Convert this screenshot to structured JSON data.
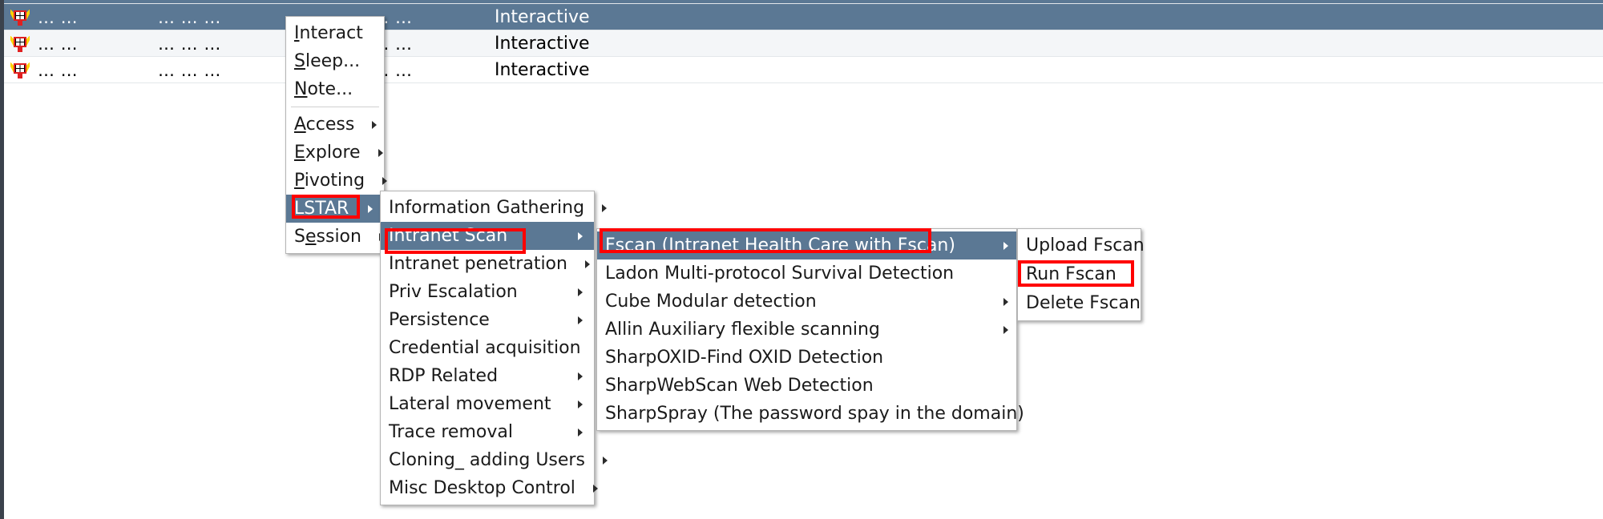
{
  "app": {
    "theme_accent": "#5b7894",
    "highlight_box_color": "#ff0000",
    "row_alt_color": "#f4f6f8"
  },
  "beacon_table": {
    "rows": [
      {
        "icon": "beacon-monitor-icon",
        "c1": "…  …",
        "c2": "…  …  …",
        "c3": "…  …  …  …",
        "c4": "Interactive",
        "selected": true
      },
      {
        "icon": "beacon-monitor-icon",
        "c1": "…  …",
        "c2": "…  …  …",
        "c3": "…  …  …  …",
        "c4": "Interactive",
        "selected": false
      },
      {
        "icon": "beacon-monitor-icon",
        "c1": "…  …",
        "c2": "…  …  …",
        "c3": "…  …  …  …",
        "c4": "Interactive",
        "selected": false
      }
    ]
  },
  "context_menu": {
    "items": [
      {
        "label": "Interact",
        "mnemonic": "I",
        "submenu": false,
        "selected": false
      },
      {
        "label": "Sleep...",
        "mnemonic": "S",
        "submenu": false,
        "selected": false
      },
      {
        "label": "Note...",
        "mnemonic": "N",
        "submenu": false,
        "selected": false
      },
      {
        "separator": true
      },
      {
        "label": "Access",
        "mnemonic": "A",
        "submenu": true,
        "selected": false
      },
      {
        "label": "Explore",
        "mnemonic": "E",
        "submenu": true,
        "selected": false
      },
      {
        "label": "Pivoting",
        "mnemonic": "P",
        "submenu": true,
        "selected": false
      },
      {
        "label": "LSTAR",
        "mnemonic": "L",
        "submenu": true,
        "selected": true,
        "highlighted": true
      },
      {
        "label": "Session",
        "mnemonic": "e",
        "submenu": true,
        "selected": false
      }
    ]
  },
  "lstar_menu": {
    "items": [
      {
        "label": "Information Gathering",
        "submenu": true,
        "selected": false
      },
      {
        "label": "Intranet Scan",
        "submenu": true,
        "selected": true,
        "highlighted": true
      },
      {
        "label": "Intranet penetration",
        "submenu": true,
        "selected": false
      },
      {
        "label": "Priv Escalation",
        "submenu": true,
        "selected": false
      },
      {
        "label": "Persistence",
        "submenu": true,
        "selected": false
      },
      {
        "label": "Credential acquisition",
        "submenu": true,
        "selected": false
      },
      {
        "label": "RDP Related",
        "submenu": true,
        "selected": false
      },
      {
        "label": "Lateral movement",
        "submenu": true,
        "selected": false
      },
      {
        "label": "Trace removal",
        "submenu": true,
        "selected": false
      },
      {
        "label": "Cloning_ adding Users",
        "submenu": true,
        "selected": false
      },
      {
        "label": "Misc Desktop Control",
        "submenu": true,
        "selected": false
      }
    ]
  },
  "intranet_scan_menu": {
    "items": [
      {
        "label": "Fscan (Intranet Health Care with Fscan)",
        "submenu": true,
        "selected": true,
        "highlighted": true
      },
      {
        "label": "Ladon Multi-protocol Survival Detection",
        "submenu": false,
        "selected": false
      },
      {
        "label": "Cube Modular detection",
        "submenu": true,
        "selected": false
      },
      {
        "label": "Allin Auxiliary flexible scanning",
        "submenu": true,
        "selected": false
      },
      {
        "label": "SharpOXID-Find OXID Detection",
        "submenu": false,
        "selected": false
      },
      {
        "label": "SharpWebScan Web Detection",
        "submenu": false,
        "selected": false
      },
      {
        "label": "SharpSpray (The password spay in the domain)",
        "submenu": false,
        "selected": false
      }
    ]
  },
  "fscan_menu": {
    "items": [
      {
        "label": "Upload Fscan",
        "submenu": false,
        "selected": false
      },
      {
        "label": "Run Fscan",
        "submenu": false,
        "selected": false,
        "highlighted": true
      },
      {
        "label": "Delete Fscan",
        "submenu": false,
        "selected": false
      }
    ]
  }
}
